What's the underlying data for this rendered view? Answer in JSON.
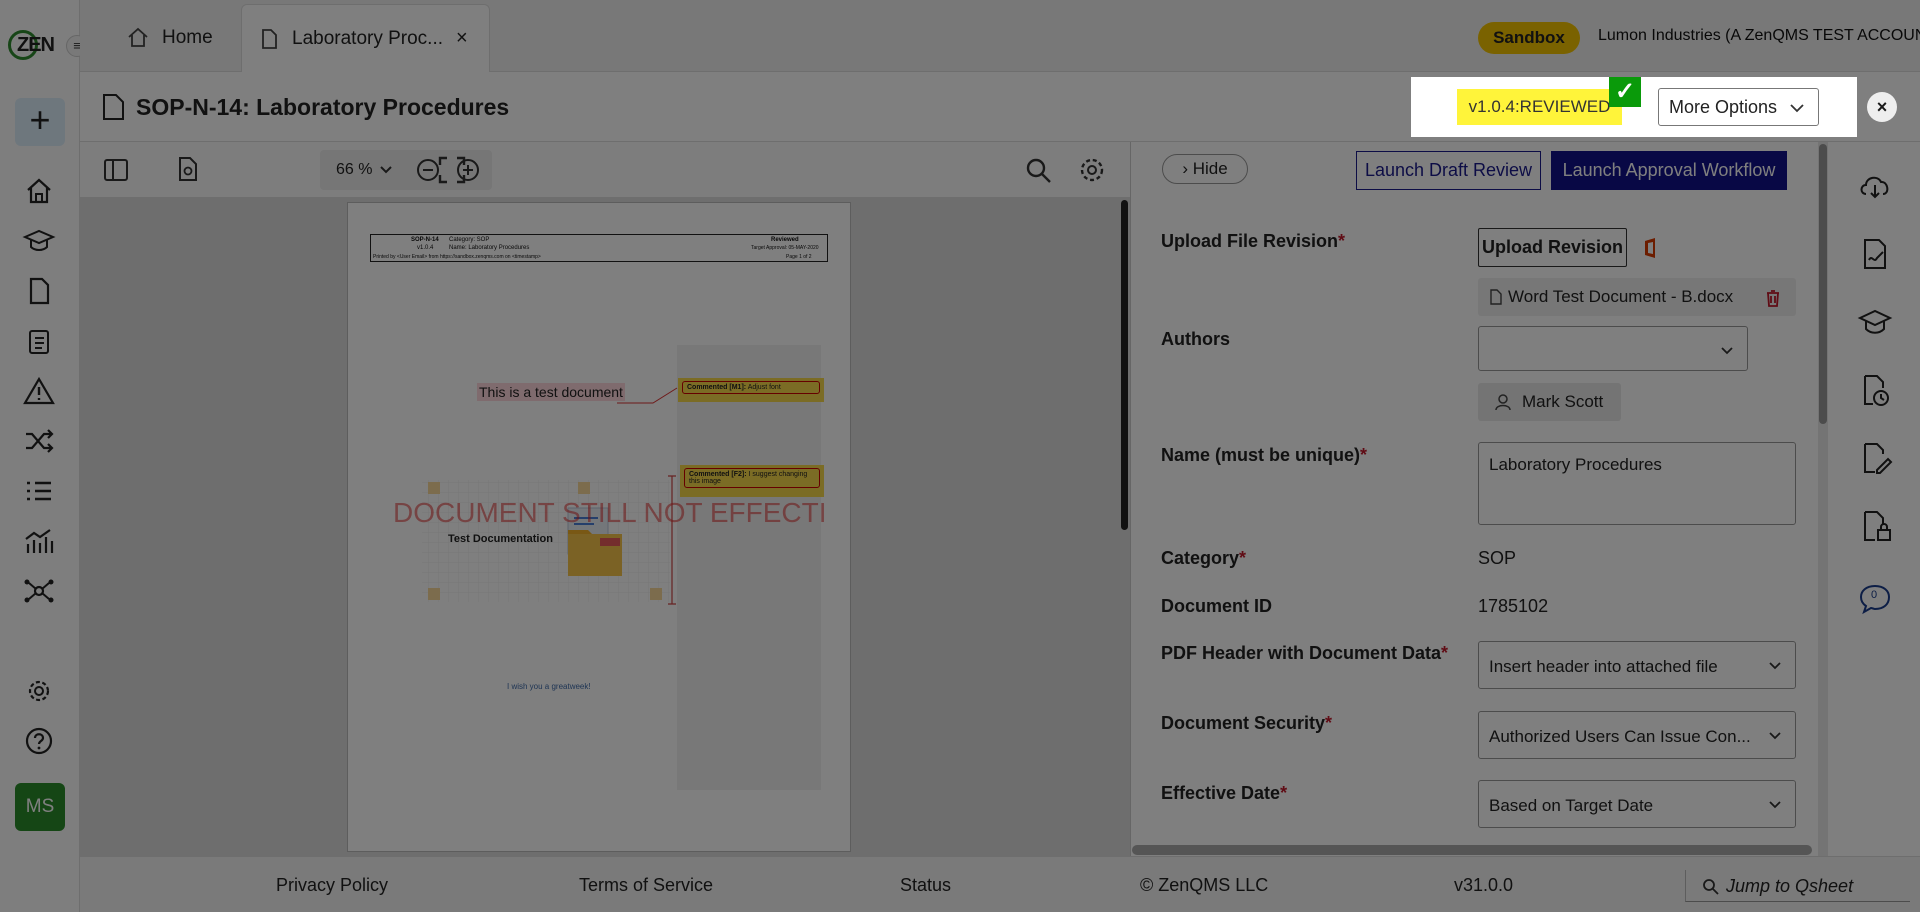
{
  "logo_text": "ZEN",
  "tabs": [
    {
      "label": "Home",
      "icon": "home-icon"
    },
    {
      "label": "Laboratory Proc...",
      "icon": "document-icon",
      "close": "×"
    }
  ],
  "header": {
    "sandbox_badge": "Sandbox",
    "account": "Lumon Industries (A ZenQMS TEST ACCOUNT)"
  },
  "document": {
    "title": "SOP-N-14: Laboratory Procedures",
    "version": "v1.0.4:REVIEWED",
    "more_options": "More Options",
    "close": "×"
  },
  "viewer": {
    "zoom": "66 %",
    "page_header": {
      "doc_id": "SOP-N-14",
      "doc_ver": "v1.0.4",
      "category": "Category: SOP",
      "name": "Name: Laboratory Procedures",
      "status": "Reviewed",
      "approval": "Target Approval: 05-MAY-2020",
      "printed_by": "Printed by <User Email> from https://sandbox.zenqms.com on <timestamp>",
      "page": "Page 1 of 2"
    },
    "content": {
      "heading": "This is a test document",
      "image_caption": "Test Documentation",
      "watermark": "DOCUMENT STILL NOT EFFECTI",
      "footer_text": "I wish you a greatweek!"
    },
    "comments": [
      {
        "author": "Commented [M1]:",
        "text": "Adjust font"
      },
      {
        "author": "Commented [F2]:",
        "text": "I suggest changing this image"
      }
    ]
  },
  "form_actions": {
    "hide": "Hide",
    "draft_review": "Launch Draft Review",
    "approval_workflow": "Launch Approval Workflow"
  },
  "fields": {
    "upload_label": "Upload File Revision",
    "upload_button": "Upload Revision",
    "file_name": "Word Test Document - B.docx",
    "authors_label": "Authors",
    "author_name": "Mark Scott",
    "name_label": "Name (must be unique)",
    "name_value": "Laboratory Procedures",
    "category_label": "Category",
    "category_value": "SOP",
    "docid_label": "Document ID",
    "docid_value": "1785102",
    "pdfheader_label": "PDF Header with Document Data",
    "pdfheader_value": "Insert header into attached file",
    "security_label": "Document Security",
    "security_value": "Authorized Users Can Issue Con...",
    "effective_label": "Effective Date",
    "effective_value": "Based on Target Date",
    "required_mark": "*"
  },
  "right_badge": "0",
  "user_initials": "MS",
  "footer": {
    "privacy": "Privacy Policy",
    "terms": "Terms of Service",
    "status": "Status",
    "copyright": "© ZenQMS LLC",
    "version": "v31.0.0",
    "jump": "Jump to Qsheet"
  },
  "colors": {
    "sandbox": "#f5c400",
    "approval": "#10108a",
    "check": "#0a9a0a",
    "version_highlight": "#fff43a"
  }
}
